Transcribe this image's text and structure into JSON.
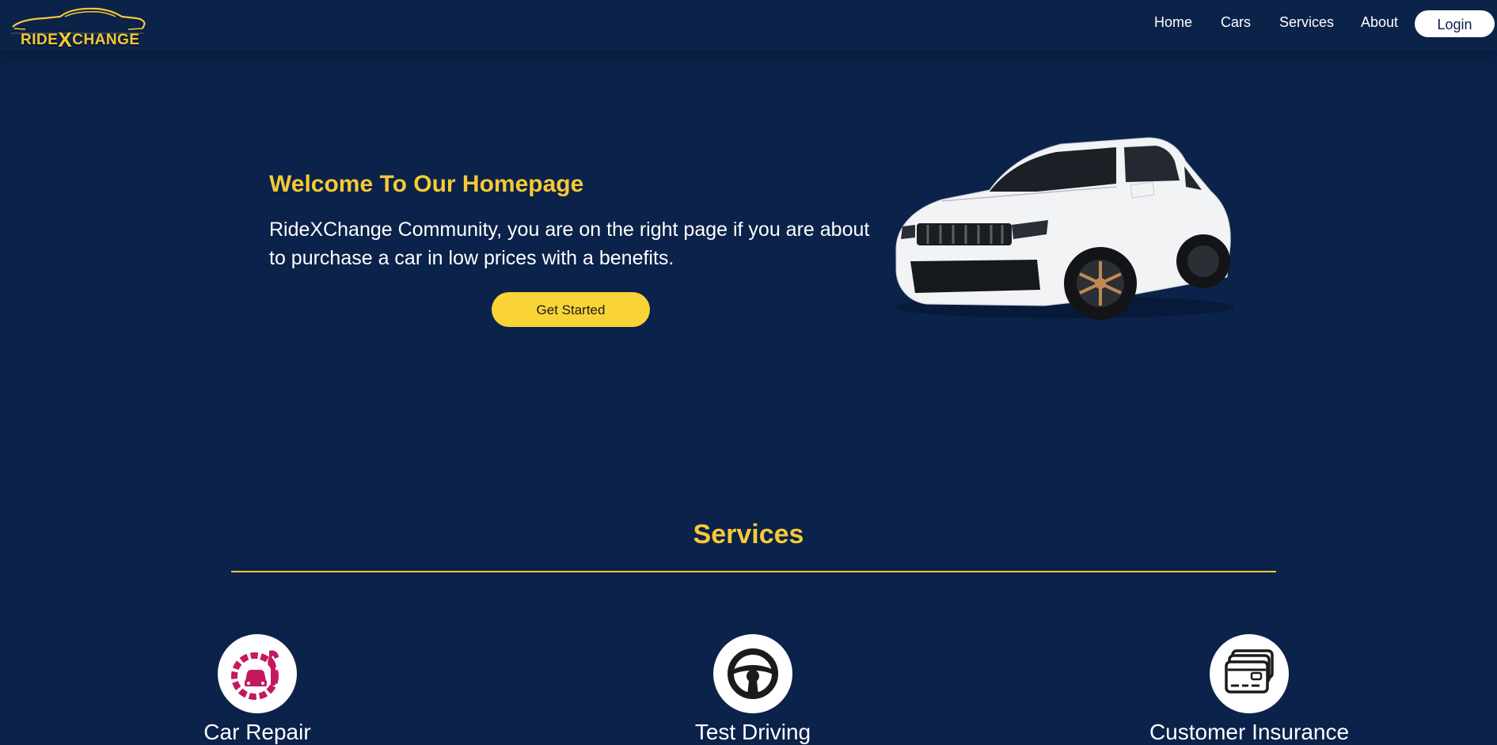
{
  "brand": {
    "name_prefix": "RIDE",
    "name_x": "X",
    "name_suffix": "CHANGE"
  },
  "nav": {
    "items": [
      {
        "label": "Home"
      },
      {
        "label": "Cars"
      },
      {
        "label": "Services"
      },
      {
        "label": "About"
      }
    ],
    "login_label": "Login"
  },
  "hero": {
    "title": "Welcome To Our Homepage",
    "text": "RideXChange Community, you are on the right page if you are about to purchase a car in low prices with a benefits.",
    "cta_label": "Get Started",
    "image_icon": "white-suv-car-icon"
  },
  "services": {
    "title": "Services",
    "items": [
      {
        "label": "Car Repair",
        "icon": "car-repair-icon"
      },
      {
        "label": "Test Driving",
        "icon": "steering-wheel-icon"
      },
      {
        "label": "Customer Insurance",
        "icon": "credit-card-icon"
      }
    ]
  },
  "colors": {
    "background": "#0b224a",
    "accent": "#f6c935",
    "button": "#fad437",
    "repair_icon": "#c4185f"
  }
}
